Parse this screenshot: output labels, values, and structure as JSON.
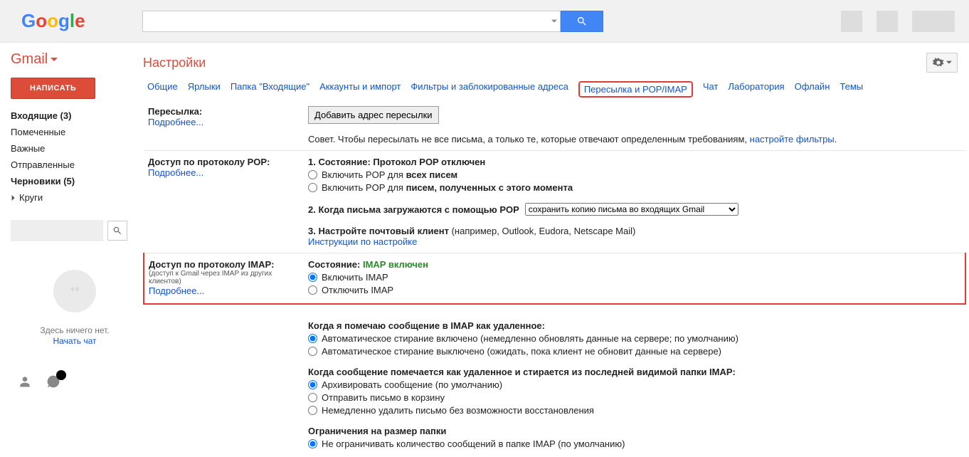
{
  "search": {
    "placeholder": ""
  },
  "sidebar": {
    "gmail_label": "Gmail",
    "compose": "НАПИСАТЬ",
    "items": [
      {
        "label": "Входящие (3)",
        "bold": true
      },
      {
        "label": "Помеченные"
      },
      {
        "label": "Важные"
      },
      {
        "label": "Отправленные"
      },
      {
        "label": "Черновики (5)",
        "bold": true
      },
      {
        "label": "Круги",
        "collapsible": true
      }
    ],
    "hangouts_empty": "Здесь ничего нет.",
    "hangouts_start": "Начать чат"
  },
  "main": {
    "title": "Настройки",
    "tabs": [
      "Общие",
      "Ярлыки",
      "Папка \"Входящие\"",
      "Аккаунты и импорт",
      "Фильтры и заблокированные адреса",
      "Пересылка и POP/IMAP",
      "Чат",
      "Лаборатория",
      "Офлайн",
      "Темы"
    ],
    "active_tab_index": 5,
    "forwarding": {
      "title": "Пересылка:",
      "more": "Подробнее...",
      "add_button": "Добавить адрес пересылки",
      "tip_prefix": "Совет. Чтобы пересылать не все письма, а только те, которые отвечают определенным требованиям, ",
      "tip_link": "настройте фильтры",
      "tip_suffix": "."
    },
    "pop": {
      "title": "Доступ по протоколу POP:",
      "more": "Подробнее...",
      "status_label": "1. Состояние: ",
      "status_value": "Протокол POP отключен",
      "enable_all_prefix": "Включить POP для ",
      "enable_all_bold": "всех писем",
      "enable_now_prefix": "Включить POP для ",
      "enable_now_bold": "писем, полученных с этого момента",
      "download_label": "2. Когда письма загружаются с помощью POP",
      "download_select": "сохранить копию письма во входящих Gmail",
      "configure_label": "3. Настройте почтовый клиент",
      "configure_example": " (например, Outlook, Eudora, Netscape Mail)",
      "configure_link": "Инструкции по настройке"
    },
    "imap": {
      "title": "Доступ по протоколу IMAP:",
      "subtitle": "(доступ к Gmail через IMAP из других клиентов)",
      "more": "Подробнее...",
      "status_label": "Состояние: ",
      "status_value": "IMAP включен",
      "enable": "Включить IMAP",
      "disable": "Отключить IMAP",
      "delete_heading": "Когда я помечаю сообщение в IMAP как удаленное:",
      "auto_on": "Автоматическое стирание включено (немедленно обновлять данные на сервере; по умолчанию)",
      "auto_off": "Автоматическое стирание выключено (ожидать, пока клиент не обновит данные на сервере)",
      "expunge_heading": "Когда сообщение помечается как удаленное и стирается из последней видимой папки IMAP:",
      "archive": "Архивировать сообщение (по умолчанию)",
      "trash": "Отправить письмо в корзину",
      "delete_now": "Немедленно удалить письмо без возможности восстановления",
      "folder_heading": "Ограничения на размер папки",
      "folder_nolimit": "Не ограничивать количество сообщений в папке IMAP (по умолчанию)"
    }
  }
}
